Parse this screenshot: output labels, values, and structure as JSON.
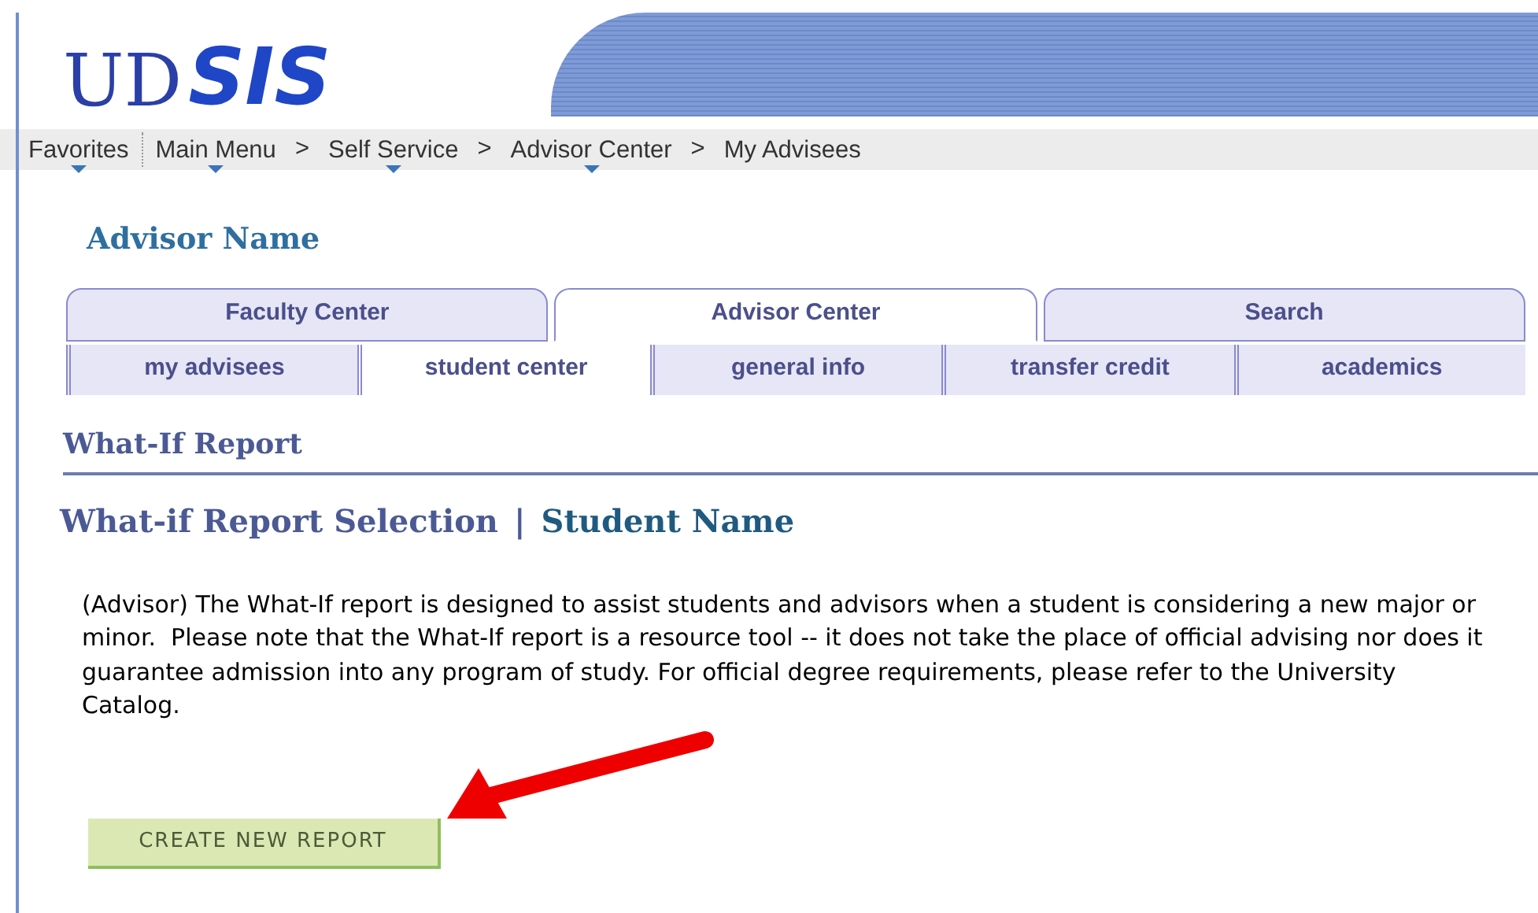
{
  "logo": {
    "mark": "UD",
    "text": "SIS"
  },
  "breadcrumbs": [
    {
      "label": "Favorites",
      "has_menu": true
    },
    {
      "label": "Main Menu",
      "has_menu": true,
      "separator": ">"
    },
    {
      "label": "Self Service",
      "has_menu": true,
      "separator": ">"
    },
    {
      "label": "Advisor Center",
      "has_menu": true,
      "separator": ">"
    },
    {
      "label": "My Advisees",
      "has_menu": false
    }
  ],
  "user_name": "Advisor Name",
  "tabs": [
    {
      "label": "Faculty Center",
      "selected": false
    },
    {
      "label": "Advisor Center",
      "selected": true
    },
    {
      "label": "Search",
      "selected": false
    }
  ],
  "subtabs": [
    {
      "label": "my advisees",
      "selected": false
    },
    {
      "label": "student center",
      "selected": true
    },
    {
      "label": "general info",
      "selected": false
    },
    {
      "label": "transfer credit",
      "selected": false
    },
    {
      "label": "academics",
      "selected": false
    }
  ],
  "page_title": "What-If Report",
  "section_title": "What-if Report Selection",
  "section_divider": "|",
  "student_name": "Student Name",
  "description": "(Advisor) The What-If report is designed to assist students and advisors when a student is considering a new major or minor.  Please note that the What-If report is a resource tool -- it does not take the place of official advising nor does it guarantee admission into any program of study. For official degree requirements, please refer to the University Catalog.",
  "create_button": "CREATE NEW REPORT"
}
